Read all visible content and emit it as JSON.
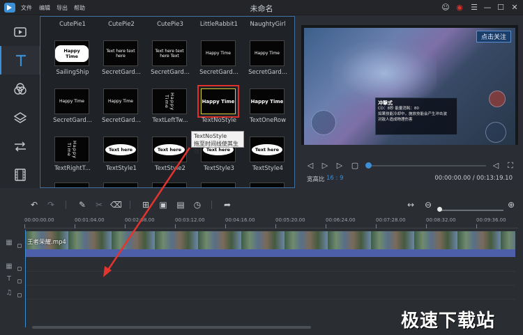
{
  "window": {
    "title": "未命名",
    "menu": [
      "文件",
      "编辑",
      "导出",
      "帮助"
    ]
  },
  "sidebar": {
    "items": [
      {
        "name": "media",
        "icon": "video-icon"
      },
      {
        "name": "text",
        "icon": "text-t-icon",
        "active": true
      },
      {
        "name": "filters",
        "icon": "filter-circles-icon"
      },
      {
        "name": "overlays",
        "icon": "layers-icon"
      },
      {
        "name": "transitions",
        "icon": "transition-arrows-icon"
      },
      {
        "name": "elements",
        "icon": "film-icon"
      }
    ]
  },
  "library": {
    "top_row": [
      "CutePie1",
      "CutePie2",
      "CutePie3",
      "LittleRabbit1",
      "NaughtyGirl"
    ],
    "rows": [
      {
        "labels": [
          "SailingShip",
          "SecretGard...",
          "SecretGard...",
          "SecretGard...",
          "SecretGard..."
        ],
        "thumbs": [
          "Happy Time",
          "Text here text here",
          "Text here text here Text",
          "Happy Time",
          "Happy Time"
        ]
      },
      {
        "labels": [
          "SecretGard...",
          "SecretGard...",
          "TextLeftTw...",
          "TextNoStyle",
          "TextOneRow"
        ],
        "thumbs": [
          "Happy Time",
          "Happy Time",
          "Happy Time",
          "Happy Time",
          "Happy Time"
        ]
      },
      {
        "labels": [
          "TextRightT...",
          "TextStyle1",
          "TextStyle2",
          "TextStyle3",
          "TextStyle4"
        ],
        "thumbs": [
          "Happy Time",
          "Text here",
          "Text here",
          "Text here",
          "Text here"
        ]
      }
    ],
    "tooltip": {
      "title": "TextNoStyle",
      "hint": "拖至时间线使其生效"
    }
  },
  "player": {
    "video_banner": "点击关注",
    "video_card": {
      "title": "冲撃式",
      "line1": "CD：8秒  能量消耗：80",
      "line2": "如果技能冷却中，施放技能会产生冲击波",
      "line3": "对敌人造成物理伤害"
    },
    "aspect_label": "宽高比",
    "aspect_value": "16 : 9",
    "time": "00:00:00.00 / 00:13:19.10",
    "progress": 0.0
  },
  "timeline": {
    "ruler": [
      "00:00:00.00",
      "00:01:04.00",
      "00:02:08.00",
      "00:03:12.00",
      "00:04:16.00",
      "00:05:20.00",
      "00:06:24.00",
      "00:07:28.00",
      "00:08:32.00",
      "00:09:36.00"
    ],
    "clip_name": "王者荣耀.mp4",
    "tracks": [
      "video-track-icon",
      "overlay-track-icon",
      "text-track-icon",
      "music-track-icon"
    ]
  },
  "watermark": "极速下载站"
}
